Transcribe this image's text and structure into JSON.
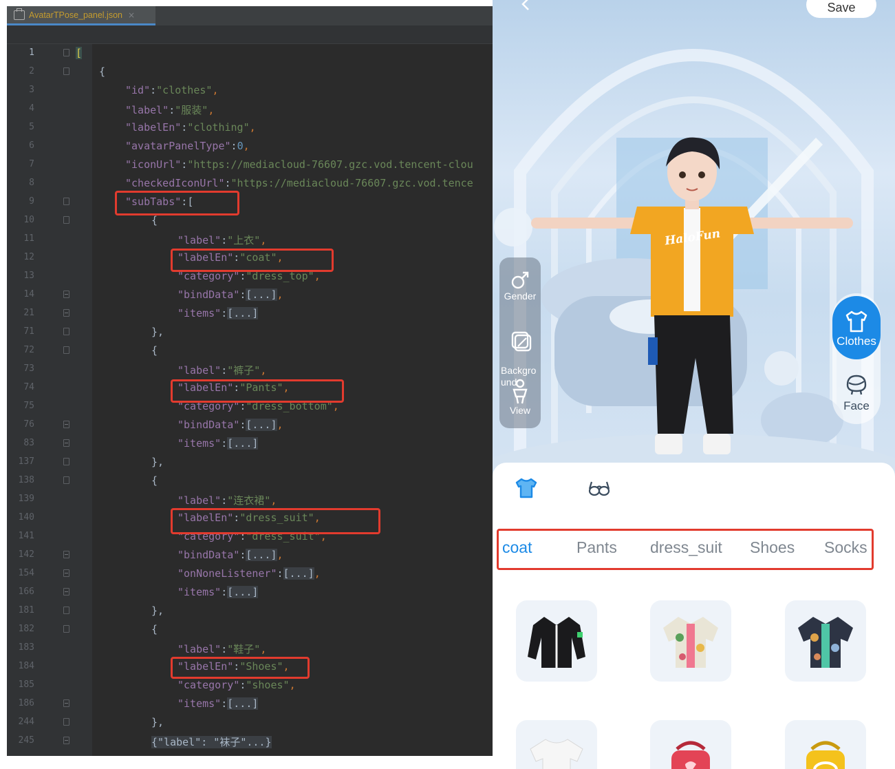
{
  "editor": {
    "tab_title": "AvatarTPose_panel.json",
    "tab_close": "×",
    "tab_icon": "json-file-icon",
    "line_numbers": [
      "1",
      "2",
      "3",
      "4",
      "5",
      "6",
      "7",
      "8",
      "9",
      "10",
      "11",
      "12",
      "13",
      "14",
      "21",
      "71",
      "72",
      "73",
      "74",
      "75",
      "76",
      "83",
      "137",
      "138",
      "139",
      "140",
      "141",
      "142",
      "154",
      "166",
      "181",
      "182",
      "183",
      "184",
      "185",
      "186",
      "244",
      "245"
    ],
    "lines": [
      {
        "open_bracket": "["
      },
      {
        "brace": "{"
      },
      {
        "key": "\"id\"",
        "colon": ":",
        "value": "\"clothes\"",
        "comma": ","
      },
      {
        "key": "\"label\"",
        "colon": ":",
        "value": "\"服装\"",
        "comma": ","
      },
      {
        "key": "\"labelEn\"",
        "colon": ":",
        "value": "\"clothing\"",
        "comma": ","
      },
      {
        "key": "\"avatarPanelType\"",
        "colon": ":",
        "value": "0",
        "comma": ","
      },
      {
        "key": "\"iconUrl\"",
        "colon": ":",
        "value": "\"https://mediacloud-76607.gzc.vod.tencent-clou"
      },
      {
        "key": "\"checkedIconUrl\"",
        "colon": ":",
        "value": "\"https://mediacloud-76607.gzc.vod.tence"
      },
      {
        "key": "\"subTabs\"",
        "colon": ":",
        "value": "["
      },
      {
        "brace": "{"
      },
      {
        "key": "\"label\"",
        "colon": ":",
        "value": "\"上衣\"",
        "comma": ","
      },
      {
        "key": "\"labelEn\"",
        "colon": ":",
        "value": "\"coat\"",
        "comma": ","
      },
      {
        "key": "\"category\"",
        "colon": ":",
        "value": "\"dress_top\"",
        "comma": ","
      },
      {
        "key": "\"bindData\"",
        "colon": ":",
        "folded": "[...]",
        "comma": ","
      },
      {
        "key": "\"items\"",
        "colon": ":",
        "folded": "[...]"
      },
      {
        "brace": "},"
      },
      {
        "brace": "{"
      },
      {
        "key": "\"label\"",
        "colon": ":",
        "value": "\"裤子\"",
        "comma": ","
      },
      {
        "key": "\"labelEn\"",
        "colon": ":",
        "value": "\"Pants\"",
        "comma": ","
      },
      {
        "key": "\"category\"",
        "colon": ":",
        "value": "\"dress_bottom\"",
        "comma": ","
      },
      {
        "key": "\"bindData\"",
        "colon": ":",
        "folded": "[...]",
        "comma": ","
      },
      {
        "key": "\"items\"",
        "colon": ":",
        "folded": "[...]"
      },
      {
        "brace": "},"
      },
      {
        "brace": "{"
      },
      {
        "key": "\"label\"",
        "colon": ":",
        "value": "\"连衣裙\"",
        "comma": ","
      },
      {
        "key": "\"labelEn\"",
        "colon": ":",
        "value": "\"dress_suit\"",
        "comma": ","
      },
      {
        "key": "\"category\"",
        "colon": ":",
        "value": "\"dress_suit\"",
        "comma": ","
      },
      {
        "key": "\"bindData\"",
        "colon": ":",
        "folded": "[...]",
        "comma": ","
      },
      {
        "key": "\"onNoneListener\"",
        "colon": ":",
        "folded": "[...]",
        "comma": ","
      },
      {
        "key": "\"items\"",
        "colon": ":",
        "folded": "[...]"
      },
      {
        "brace": "},"
      },
      {
        "brace": "{"
      },
      {
        "key": "\"label\"",
        "colon": ":",
        "value": "\"鞋子\"",
        "comma": ","
      },
      {
        "key": "\"labelEn\"",
        "colon": ":",
        "value": "\"Shoes\"",
        "comma": ","
      },
      {
        "key": "\"category\"",
        "colon": ":",
        "value": "\"shoes\"",
        "comma": ","
      },
      {
        "key": "\"items\"",
        "colon": ":",
        "folded": "[...]"
      },
      {
        "brace": "},"
      },
      {
        "folded_object": "{\"label\": \"袜子\"...}"
      }
    ]
  },
  "phone": {
    "save_label": "Save",
    "back_icon": "back-arrow-icon",
    "left_rail": [
      {
        "label": "Gender",
        "icon": "gender-icon"
      },
      {
        "label": "Backgro\nund",
        "icon": "background-icon"
      },
      {
        "label": "View",
        "icon": "view-icon"
      }
    ],
    "right_rail": [
      {
        "label": "Clothes",
        "icon": "shirt-icon",
        "active": true
      },
      {
        "label": "Face",
        "icon": "face-icon",
        "active": false
      }
    ],
    "avatar_shirt_text": "HaloFun",
    "categories": [
      {
        "icon": "shirt-icon",
        "active": true
      },
      {
        "icon": "glasses-icon",
        "active": false
      }
    ],
    "subtabs": [
      "coat",
      "Pants",
      "dress_suit",
      "Shoes",
      "Socks"
    ],
    "active_subtab": "coat",
    "items": [
      {
        "icon": "black-jacket-icon"
      },
      {
        "icon": "floral-shirt-icon"
      },
      {
        "icon": "dark-floral-shirt-icon"
      },
      {
        "icon": "white-tshirt-icon"
      },
      {
        "icon": "red-bag-icon"
      },
      {
        "icon": "yellow-bag-icon"
      }
    ]
  },
  "colors": {
    "accent": "#1c8ae6",
    "highlight": "#e23b2e",
    "editor_bg": "#2b2b2b",
    "json_key": "#9876aa",
    "json_string": "#6a8759",
    "json_number": "#6897bb"
  }
}
